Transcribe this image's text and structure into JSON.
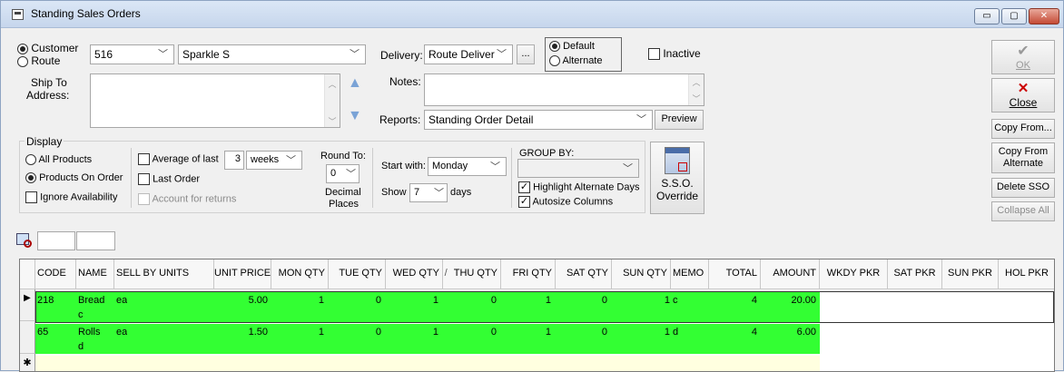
{
  "window": {
    "title": "Standing Sales Orders",
    "min": "▭",
    "max": "▢",
    "close": "✕"
  },
  "selector": {
    "customer_label": "Customer",
    "route_label": "Route",
    "customer_id": "516",
    "customer_name": "Sparkle S"
  },
  "ship_to": {
    "label_line1": "Ship To",
    "label_line2": "Address:"
  },
  "delivery": {
    "label": "Delivery:",
    "value": "Route Deliver",
    "ellipsis": "..."
  },
  "address_mode": {
    "default_label": "Default",
    "alternate_label": "Alternate",
    "selected": "Default"
  },
  "inactive": {
    "label": "Inactive",
    "checked": false
  },
  "notes": {
    "label": "Notes:"
  },
  "reports": {
    "label": "Reports:",
    "value": "Standing Order Detail",
    "preview": "Preview"
  },
  "display": {
    "title": "Display",
    "all_products": "All Products",
    "products_on_order": "Products On Order",
    "ignore_availability": "Ignore Availability",
    "average_label": "Average of last",
    "average_value": "3",
    "average_unit": "weeks",
    "last_order": "Last Order",
    "account_returns": "Account for returns",
    "round_to_label": "Round To:",
    "round_value": "0",
    "decimal_label_1": "Decimal",
    "decimal_label_2": "Places",
    "start_with_label": "Start with:",
    "start_with_value": "Monday",
    "show_label": "Show",
    "show_value": "7",
    "days_label": "days",
    "group_by_label": "GROUP BY:",
    "group_by_value": "",
    "highlight_alt": "Highlight Alternate Days",
    "autosize": "Autosize Columns",
    "override_line1": "S.S.O.",
    "override_line2": "Override"
  },
  "side_buttons": {
    "ok": "OK",
    "close": "Close",
    "copy_from": "Copy From...",
    "copy_alt_1": "Copy From",
    "copy_alt_2": "Alternate",
    "delete_sso": "Delete SSO",
    "collapse_all": "Collapse All"
  },
  "grid": {
    "columns": [
      "CODE",
      "NAME",
      "SELL BY UNITS",
      "UNIT PRICE",
      "MON QTY",
      "TUE QTY",
      "WED QTY",
      "THU QTY",
      "FRI QTY",
      "SAT QTY",
      "SUN QTY",
      "MEMO",
      "TOTAL",
      "AMOUNT",
      "WKDY PKR",
      "SAT PKR",
      "SUN PKR",
      "HOL PKR"
    ],
    "rows": [
      {
        "code": "218",
        "name": "Bread",
        "sub": "c",
        "units": "ea",
        "price": "5.00",
        "mon": "1",
        "tue": "0",
        "wed": "1",
        "thu": "0",
        "fri": "1",
        "sat": "0",
        "sun": "1",
        "memo": "c",
        "total": "4",
        "amount": "20.00"
      },
      {
        "code": "65",
        "name": "Rolls",
        "sub": "d",
        "units": "ea",
        "price": "1.50",
        "mon": "1",
        "tue": "0",
        "wed": "1",
        "thu": "0",
        "fri": "1",
        "sat": "0",
        "sun": "1",
        "memo": "d",
        "total": "4",
        "amount": "6.00"
      }
    ],
    "current_row_marker": "▶",
    "new_row_marker": "✱",
    "thu_sort_glyph": "/"
  }
}
